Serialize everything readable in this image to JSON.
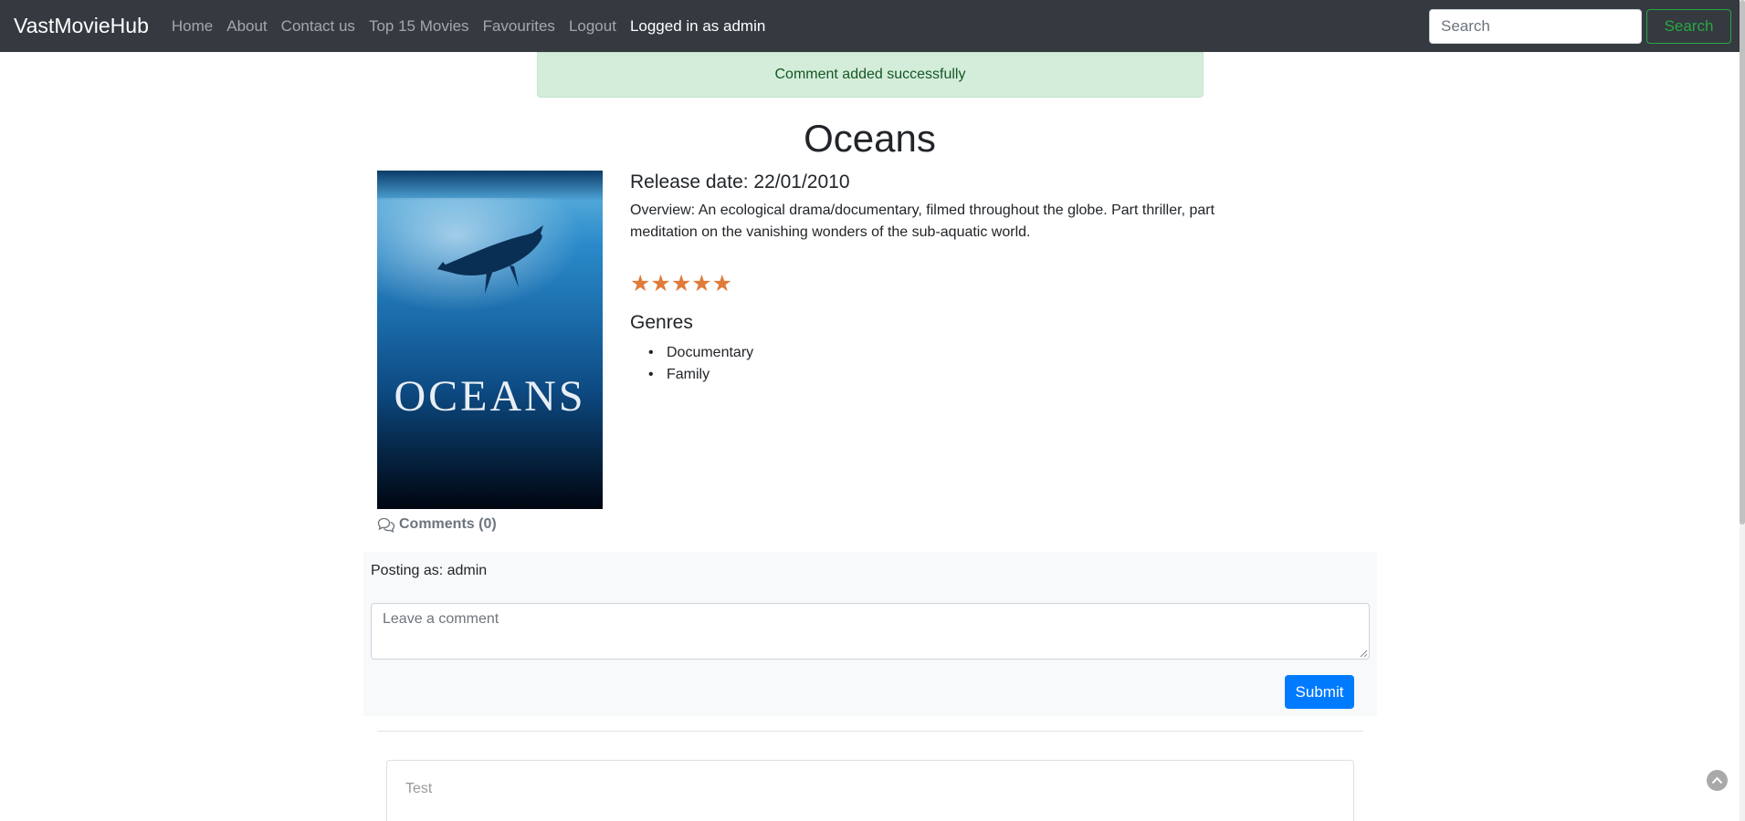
{
  "navbar": {
    "brand": "VastMovieHub",
    "links": [
      {
        "label": "Home"
      },
      {
        "label": "About"
      },
      {
        "label": "Contact us"
      },
      {
        "label": "Top 15 Movies"
      },
      {
        "label": "Favourites"
      },
      {
        "label": "Logout"
      }
    ],
    "logged_in_text": "Logged in as admin",
    "search_placeholder": "Search",
    "search_button": "Search"
  },
  "alert": {
    "message": "Comment added successfully"
  },
  "movie": {
    "title": "Oceans",
    "poster_title": "OCEANS",
    "release_date": "Release date: 22/01/2010",
    "overview": "Overview: An ecological drama/documentary, filmed throughout the globe. Part thriller, part meditation on the vanishing wonders of the sub-aquatic world.",
    "rating_stars": "★★★★★",
    "rating_value": 5,
    "rating_max": 5,
    "genres_heading": "Genres",
    "genres": [
      "Documentary",
      "Family"
    ]
  },
  "comments": {
    "link_label": "Comments (0)",
    "posting_as": "Posting as: admin",
    "placeholder": "Leave a comment",
    "submit_label": "Submit",
    "items": [
      {
        "text": "Test"
      }
    ]
  },
  "colors": {
    "navbar_bg": "#343a40",
    "alert_bg": "#d4edda",
    "alert_text": "#155724",
    "star_color": "#e07b39",
    "primary": "#007bff",
    "success": "#28a745"
  }
}
